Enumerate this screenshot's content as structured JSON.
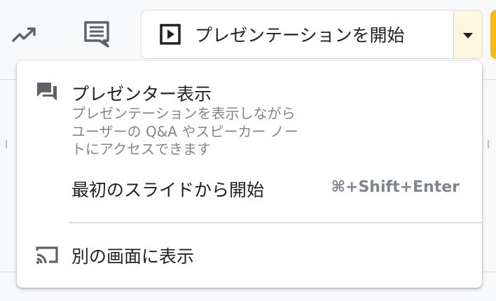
{
  "toolbar": {
    "icons": [
      "trending-up-icon",
      "comment-icon"
    ],
    "present_button": {
      "label": "プレゼンテーションを開始",
      "icon": "play-slideshow-icon"
    },
    "dropdown": {
      "icon": "caret-down-icon"
    },
    "colors": {
      "dropdown_bg": "#fef7e0",
      "accent_yellow": "#fbbc04"
    }
  },
  "menu": {
    "presenter_view": {
      "icon": "presenter-view-icon",
      "title": "プレゼンター表示",
      "description": [
        "プレゼンテーションを表示しながら",
        "ユーザーの Q&A やスピーカー ノー",
        "トにアクセスできます"
      ]
    },
    "start_from_beginning": {
      "title": "最初のスライドから開始",
      "shortcut": "⌘+Shift+Enter"
    },
    "present_on_another_screen": {
      "icon": "cast-icon",
      "title": "別の画面に表示"
    }
  }
}
